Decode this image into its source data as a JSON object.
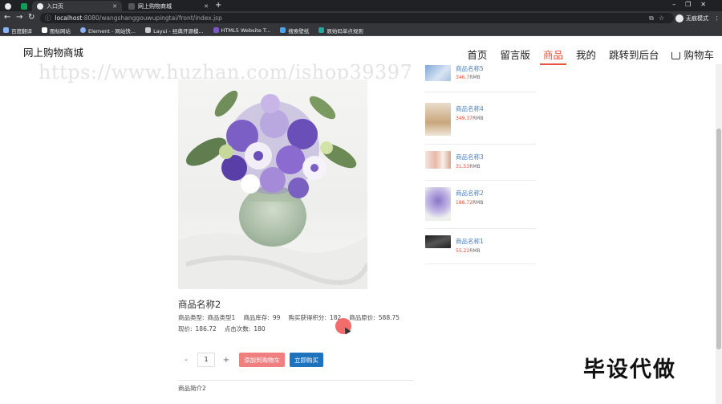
{
  "browser": {
    "tabs": [
      {
        "label": ""
      },
      {
        "label": ""
      },
      {
        "label": "入口页"
      },
      {
        "label": "网上购物商城"
      }
    ],
    "url_host": "localhost",
    "url_path": ":8080/wangshanggouwupingtai/front/index.jsp",
    "profile_label": "无痕模式",
    "bookmarks": [
      "百度翻译",
      "图标网站",
      "Element - 网站快...",
      "Layui - 经典开源模...",
      "HTML5 Website T...",
      "搜索壁纸",
      "原始码单点规则"
    ]
  },
  "site": {
    "title": "网上购物商城",
    "nav": [
      "首页",
      "留言版",
      "商品",
      "我的",
      "跳转到后台",
      "购物车"
    ],
    "active_nav_index": 2
  },
  "watermark": "https://www.huzhan.com/ishop39397",
  "product": {
    "name": "商品名称2",
    "meta_line1": [
      {
        "k": "商品类型:",
        "v": "商品类型1"
      },
      {
        "k": "商品库存:",
        "v": "99"
      },
      {
        "k": "购买获得积分:",
        "v": "182"
      },
      {
        "k": "商品原价:",
        "v": "588.75"
      }
    ],
    "meta_line2": [
      {
        "k": "现价:",
        "v": "186.72"
      },
      {
        "k": "点击次数:",
        "v": "180"
      }
    ],
    "qty": "1",
    "minus": "-",
    "plus": "+",
    "add_cart": "添加到购物车",
    "buy_now": "立即购买",
    "desc": "商品简介2"
  },
  "related": [
    {
      "name": "商品名称5",
      "price": "346.7",
      "unit": "RMB"
    },
    {
      "name": "商品名称4",
      "price": "349.37",
      "unit": "RMB"
    },
    {
      "name": "商品名称3",
      "price": "31.53",
      "unit": "RMB"
    },
    {
      "name": "商品名称2",
      "price": "186.72",
      "unit": "RMB"
    },
    {
      "name": "商品名称1",
      "price": "55.22",
      "unit": "RMB"
    }
  ],
  "promo": "毕设代做",
  "colors": {
    "accent": "#e8523f",
    "link": "#4a7fbf",
    "buy": "#1e73be",
    "cart": "#f08080"
  }
}
